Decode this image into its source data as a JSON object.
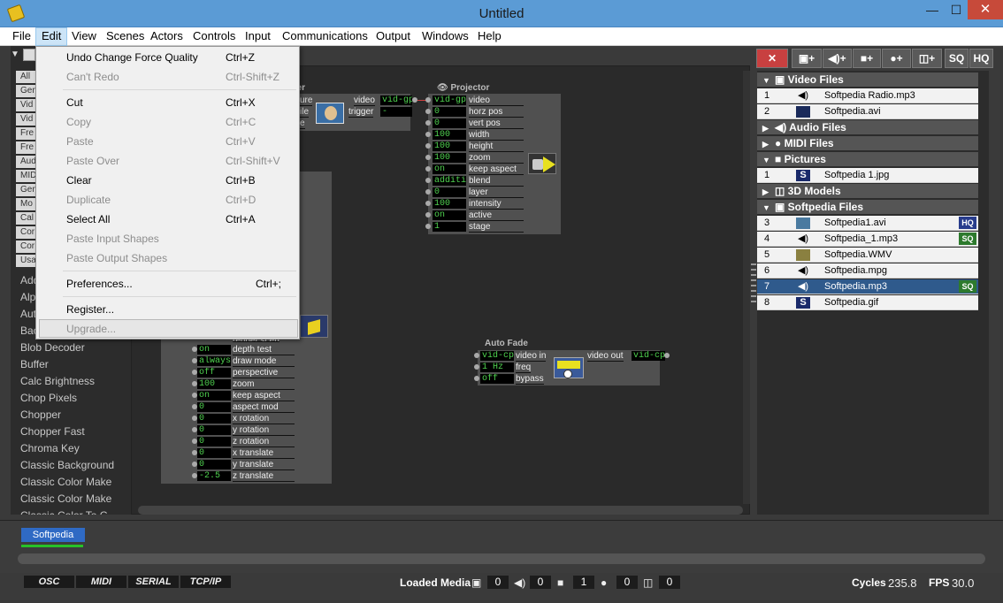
{
  "window": {
    "title": "Untitled",
    "min_label": "—",
    "max_label": "☐",
    "close_label": "✕"
  },
  "menu": [
    "File",
    "Edit",
    "View",
    "Scenes",
    "Actors",
    "Controls",
    "Input",
    "Communications",
    "Output",
    "Windows",
    "Help"
  ],
  "edit_menu": {
    "items": [
      {
        "label": "Undo Change Force Quality",
        "shortcut": "Ctrl+Z",
        "enabled": true
      },
      {
        "label": "Can't Redo",
        "shortcut": "Ctrl-Shift+Z",
        "enabled": false
      },
      {
        "label": "Cut",
        "shortcut": "Ctrl+X",
        "enabled": true
      },
      {
        "label": "Copy",
        "shortcut": "Ctrl+C",
        "enabled": false
      },
      {
        "label": "Paste",
        "shortcut": "Ctrl+V",
        "enabled": false
      },
      {
        "label": "Paste Over",
        "shortcut": "Ctrl-Shift+V",
        "enabled": false
      },
      {
        "label": "Clear",
        "shortcut": "Ctrl+B",
        "enabled": true
      },
      {
        "label": "Duplicate",
        "shortcut": "Ctrl+D",
        "enabled": false
      },
      {
        "label": "Select All",
        "shortcut": "Ctrl+A",
        "enabled": true
      },
      {
        "label": "Paste Input Shapes",
        "shortcut": "",
        "enabled": false
      },
      {
        "label": "Paste Output Shapes",
        "shortcut": "",
        "enabled": false
      },
      {
        "label": "Preferences...",
        "shortcut": "Ctrl+;",
        "enabled": true
      },
      {
        "label": "Register...",
        "shortcut": "",
        "enabled": true
      },
      {
        "label": "Upgrade...",
        "shortcut": "",
        "enabled": false
      }
    ]
  },
  "left_panel": {
    "categories": [
      "All",
      "Gen",
      "Vid",
      "Vid",
      "Fre",
      "Fre",
      "Aud",
      "MID",
      "Gen",
      "Mo",
      "Cal",
      "Cor",
      "Cor",
      "Usa"
    ],
    "actors": [
      "Add",
      "Alp",
      "Aut",
      "Bac",
      "Blob Decoder",
      "Buffer",
      "Calc Brightness",
      "Chop Pixels",
      "Chopper",
      "Chopper Fast",
      "Chroma Key",
      "Classic Background",
      "Classic Color Make",
      "Classic Color Make",
      "Classic Color To G"
    ]
  },
  "nodes": {
    "player": {
      "title": "yer",
      "in_labels": [
        "ure",
        "ile",
        "e"
      ],
      "out_labels": [
        "video",
        "trigger"
      ],
      "out_values": [
        "vid-gpu",
        "-"
      ]
    },
    "projector": {
      "title": "Projector",
      "values": [
        "vid-gpu",
        "0",
        "0",
        "100",
        "100",
        "100",
        "on",
        "additive",
        "0",
        "100",
        "on",
        "1"
      ],
      "names": [
        "video",
        "horz pos",
        "vert pos",
        "width",
        "height",
        "zoom",
        "keep aspect",
        "blend",
        "layer",
        "intensity",
        "active",
        "stage"
      ]
    },
    "renderer": {
      "partial_label": "render scen",
      "values": [
        "on",
        "always",
        "off",
        "100",
        "on",
        "0",
        "0",
        "0",
        "0",
        "0",
        "0",
        "-2.5"
      ],
      "names": [
        "depth test",
        "draw mode",
        "perspective",
        "zoom",
        "keep aspect",
        "aspect mod",
        "x rotation",
        "y rotation",
        "z rotation",
        "x translate",
        "y translate",
        "z translate"
      ]
    },
    "autofade": {
      "title": "Auto Fade",
      "in_values": [
        "vid-cpu",
        "1 Hz",
        "off"
      ],
      "in_names": [
        "video in",
        "freq",
        "bypass"
      ],
      "out_name": "video out",
      "out_value": "vid-cpu"
    }
  },
  "toolbar": [
    "+",
    "+",
    "+",
    "+",
    "+",
    "SQ",
    "HQ"
  ],
  "media": {
    "sections": [
      {
        "key": "video",
        "title": "Video Files",
        "expanded": true
      },
      {
        "key": "audio",
        "title": "Audio Files",
        "expanded": false
      },
      {
        "key": "midi",
        "title": "MIDI Files",
        "expanded": false
      },
      {
        "key": "pictures",
        "title": "Pictures",
        "expanded": true
      },
      {
        "key": "models",
        "title": "3D Models",
        "expanded": false
      },
      {
        "key": "softpedia",
        "title": "Softpedia Files",
        "expanded": true
      }
    ],
    "video_files": [
      {
        "num": "1",
        "name": "Softpedia Radio.mp3",
        "icon": "speaker-icon"
      },
      {
        "num": "2",
        "name": "Softpedia.avi",
        "icon": "video-thumb"
      }
    ],
    "pictures": [
      {
        "num": "1",
        "name": "Softpedia 1.jpg",
        "icon": "s-logo-icon"
      }
    ],
    "softpedia_files": [
      {
        "num": "3",
        "name": "Softpedia1.avi",
        "icon": "video-thumb",
        "badge": "HQ"
      },
      {
        "num": "4",
        "name": "Softpedia_1.mp3",
        "icon": "speaker-icon",
        "badge": "SQ"
      },
      {
        "num": "5",
        "name": "Softpedia.WMV",
        "icon": "video-thumb",
        "badge": ""
      },
      {
        "num": "6",
        "name": "Softpedia.mpg",
        "icon": "speaker-icon",
        "badge": ""
      },
      {
        "num": "7",
        "name": "Softpedia.mp3",
        "icon": "speaker-icon",
        "badge": "SQ",
        "selected": true
      },
      {
        "num": "8",
        "name": "Softpedia.gif",
        "icon": "s-logo-icon",
        "badge": ""
      }
    ]
  },
  "scene": {
    "tab": "Softpedia"
  },
  "status": {
    "buttons": [
      "OSC",
      "MIDI",
      "SERIAL",
      "TCP/IP"
    ],
    "loaded_label": "Loaded Media",
    "counts": [
      "0",
      "0",
      "1",
      "0",
      "0"
    ],
    "cycles_label": "Cycles",
    "cycles_value": "235.8",
    "fps_label": "FPS",
    "fps_value": "30.0"
  }
}
